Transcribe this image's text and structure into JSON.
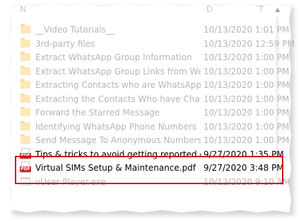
{
  "header": {
    "left_fragment": "N",
    "mid_fragment": "D",
    "right_fragment": "T"
  },
  "scroll_up_glyph": "▲",
  "files": [
    {
      "name": "__Video Tutorials__",
      "date": "10/13/2020 1:01 PM",
      "type": "folder",
      "state": "faded"
    },
    {
      "name": "3rd-party files",
      "date": "10/13/2020 12:59 PM",
      "type": "folder",
      "state": "faded"
    },
    {
      "name": "Extract WhatsApp Group Information",
      "date": "10/13/2020 1:00 PM",
      "type": "folder",
      "state": "faded"
    },
    {
      "name": "Extract WhatsApp Group Links from Web...",
      "date": "10/13/2020 1:00 PM",
      "type": "folder",
      "state": "faded"
    },
    {
      "name": "Extracting Contacts who are WhatsApp ...",
      "date": "10/13/2020 1:00 PM",
      "type": "folder",
      "state": "faded"
    },
    {
      "name": "Extracting the Contacts Who have Chatte...",
      "date": "10/13/2020 1:00 PM",
      "type": "folder",
      "state": "faded"
    },
    {
      "name": "Forward the Starred Message",
      "date": "10/13/2020 1:00 PM",
      "type": "folder",
      "state": "faded"
    },
    {
      "name": "Identifying WhatsApp Phone Numbers",
      "date": "10/13/2020 1:00 PM",
      "type": "folder",
      "state": "faded"
    },
    {
      "name": "Send Message To Anonymous Numbers",
      "date": "10/13/2020 1:00 PM",
      "type": "folder",
      "state": "faded"
    },
    {
      "name": "Tips & tricks to avoid getting reported or ...",
      "date": "9/27/2020 1:35 PM",
      "type": "pdf",
      "state": "strong"
    },
    {
      "name": "Virtual SIMs Setup & Maintenance.pdf",
      "date": "9/27/2020 3:48 PM",
      "type": "pdf",
      "state": "strong"
    },
    {
      "name": "vUser Player.exe",
      "date": "10/12/2020 9:10 AM",
      "type": "exe",
      "state": "faded"
    }
  ],
  "icons": {
    "folder": "folder-icon",
    "pdf": "pdf-file-icon",
    "exe": "application-icon",
    "pdf_badge_text": "PDF"
  },
  "colors": {
    "highlight_border": "#d0021b",
    "faded_text": "#b6b6b6",
    "strong_text": "#000000",
    "folder_fill": "#fbe7b7",
    "pdf_badge": "#d12b2b"
  }
}
